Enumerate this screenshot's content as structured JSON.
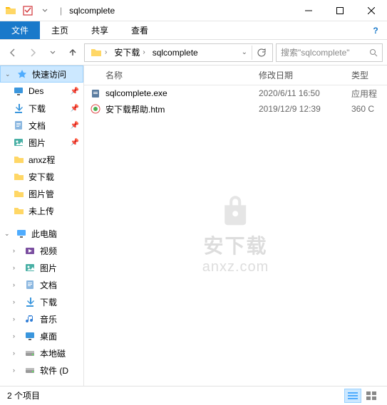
{
  "title": "sqlcomplete",
  "ribbon": {
    "file": "文件",
    "home": "主页",
    "share": "共享",
    "view": "查看"
  },
  "breadcrumb": {
    "seg1": "安下载",
    "seg2": "sqlcomplete"
  },
  "search": {
    "placeholder": "搜索\"sqlcomplete\""
  },
  "columns": {
    "name": "名称",
    "date": "修改日期",
    "type": "类型"
  },
  "sidebar": {
    "quick": "快速访问",
    "items": [
      {
        "label": "Des",
        "icon": "desktop",
        "pin": true
      },
      {
        "label": "下载",
        "icon": "download",
        "pin": true
      },
      {
        "label": "文档",
        "icon": "doc",
        "pin": true
      },
      {
        "label": "图片",
        "icon": "pic",
        "pin": true
      },
      {
        "label": "anxz程",
        "icon": "folder",
        "pin": false
      },
      {
        "label": "安下载",
        "icon": "folder",
        "pin": false
      },
      {
        "label": "图片管",
        "icon": "folder",
        "pin": false
      },
      {
        "label": "未上传",
        "icon": "folder",
        "pin": false
      }
    ],
    "thispc": "此电脑",
    "pc_items": [
      {
        "label": "视频",
        "icon": "video"
      },
      {
        "label": "图片",
        "icon": "pic"
      },
      {
        "label": "文档",
        "icon": "doc"
      },
      {
        "label": "下载",
        "icon": "download"
      },
      {
        "label": "音乐",
        "icon": "music"
      },
      {
        "label": "桌面",
        "icon": "desktop"
      },
      {
        "label": "本地磁",
        "icon": "disk"
      },
      {
        "label": "软件 (D",
        "icon": "disk"
      }
    ]
  },
  "files": [
    {
      "name": "sqlcomplete.exe",
      "date": "2020/6/11 16:50",
      "type": "应用程",
      "icon": "exe"
    },
    {
      "name": "安下载帮助.htm",
      "date": "2019/12/9 12:39",
      "type": "360 C",
      "icon": "htm"
    }
  ],
  "watermark": {
    "text1": "安下载",
    "text2": "anxz.com"
  },
  "status": {
    "count": "2 个项目"
  }
}
